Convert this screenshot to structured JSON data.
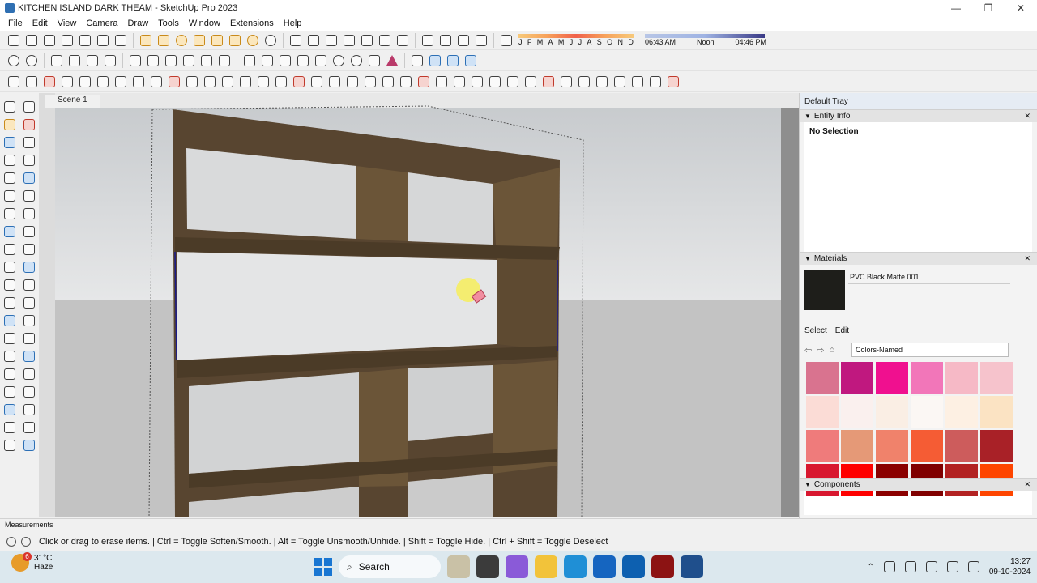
{
  "window": {
    "title": "KITCHEN ISLAND DARK THEAM - SketchUp Pro 2023"
  },
  "window_buttons": {
    "minimize": "—",
    "maximize": "❐",
    "close": "✕"
  },
  "menu": [
    "File",
    "Edit",
    "View",
    "Camera",
    "Draw",
    "Tools",
    "Window",
    "Extensions",
    "Help"
  ],
  "shadow": {
    "months": [
      "J",
      "F",
      "M",
      "A",
      "M",
      "J",
      "J",
      "A",
      "S",
      "O",
      "N",
      "D"
    ],
    "time_start": "06:43 AM",
    "time_mid": "Noon",
    "time_end": "04:46 PM"
  },
  "scene": {
    "tab": "Scene 1"
  },
  "tray": {
    "title": "Default Tray",
    "entity_info": {
      "header": "Entity Info",
      "selection": "No Selection"
    },
    "materials": {
      "header": "Materials",
      "current_name": "PVC Black Matte 001",
      "tab_select": "Select",
      "tab_edit": "Edit",
      "library": "Colors-Named",
      "swatches": [
        "#d9738f",
        "#c0187f",
        "#f0108f",
        "#f276b9",
        "#f6b9c6",
        "#f6c3cc",
        "#fbdcd6",
        "#faf0ee",
        "#faeee4",
        "#fbf7f4",
        "#fdf0e3",
        "#fbe3c3",
        "#ef7b7b",
        "#e59977",
        "#f0826b",
        "#f55c34",
        "#cd5c5c",
        "#a92127",
        "#d8172f",
        "#fe0000",
        "#8b0000",
        "#800000",
        "#b22222",
        "#fe4500"
      ]
    },
    "components": {
      "header": "Components"
    }
  },
  "measurements": {
    "label": "Measurements"
  },
  "status": {
    "text": "Click or drag to erase items. | Ctrl = Toggle Soften/Smooth. | Alt = Toggle Unsmooth/Unhide. | Shift = Toggle Hide. | Ctrl + Shift = Toggle Deselect"
  },
  "taskbar": {
    "weather_temp": "31°C",
    "weather_desc": "Haze",
    "weather_badge": "6",
    "search": "Search",
    "time": "13:27",
    "date": "09-10-2024"
  },
  "colors": {
    "accent": "#1976d2",
    "wood_dark": "#4a3a26",
    "wood_light": "#6b5538"
  }
}
